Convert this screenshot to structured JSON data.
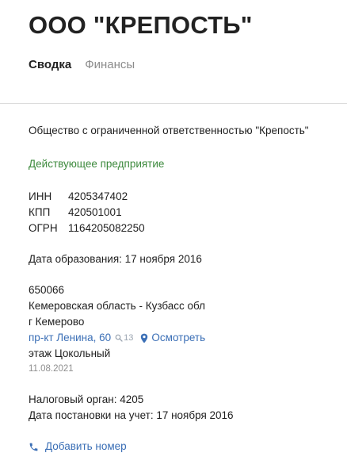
{
  "header": {
    "company_title": "ООО \"КРЕПОСТЬ\""
  },
  "tabs": [
    {
      "label": "Сводка",
      "active": true
    },
    {
      "label": "Финансы",
      "active": false
    }
  ],
  "summary": {
    "full_name": "Общество с ограниченной ответственностью \"Крепость\"",
    "status": "Действующее предприятие",
    "identifiers": [
      {
        "label": "ИНН",
        "value": "4205347402"
      },
      {
        "label": "КПП",
        "value": "420501001"
      },
      {
        "label": "ОГРН",
        "value": "1164205082250"
      }
    ],
    "registration_date": "Дата образования: 17 ноября 2016",
    "address": {
      "postal_code": "650066",
      "region": "Кемеровская область - Кузбасс обл",
      "city": "г Кемерово",
      "street": "пр-кт Ленина, 60",
      "companies_at_address": "13",
      "map_link_label": "Осмотреть",
      "detail": "этаж Цокольный",
      "date": "11.08.2021"
    },
    "tax_authority": "Налоговый орган: 4205",
    "tax_registration_date": "Дата постановки на учет: 17 ноября 2016",
    "add_phone_label": "Добавить номер"
  },
  "colors": {
    "status_green": "#3d8a3d",
    "link_blue": "#3b6fb6",
    "muted_gray": "#8c8c8c"
  },
  "icons": {
    "house_search": "search-icon",
    "map": "location-pin-icon",
    "phone": "phone-icon"
  }
}
